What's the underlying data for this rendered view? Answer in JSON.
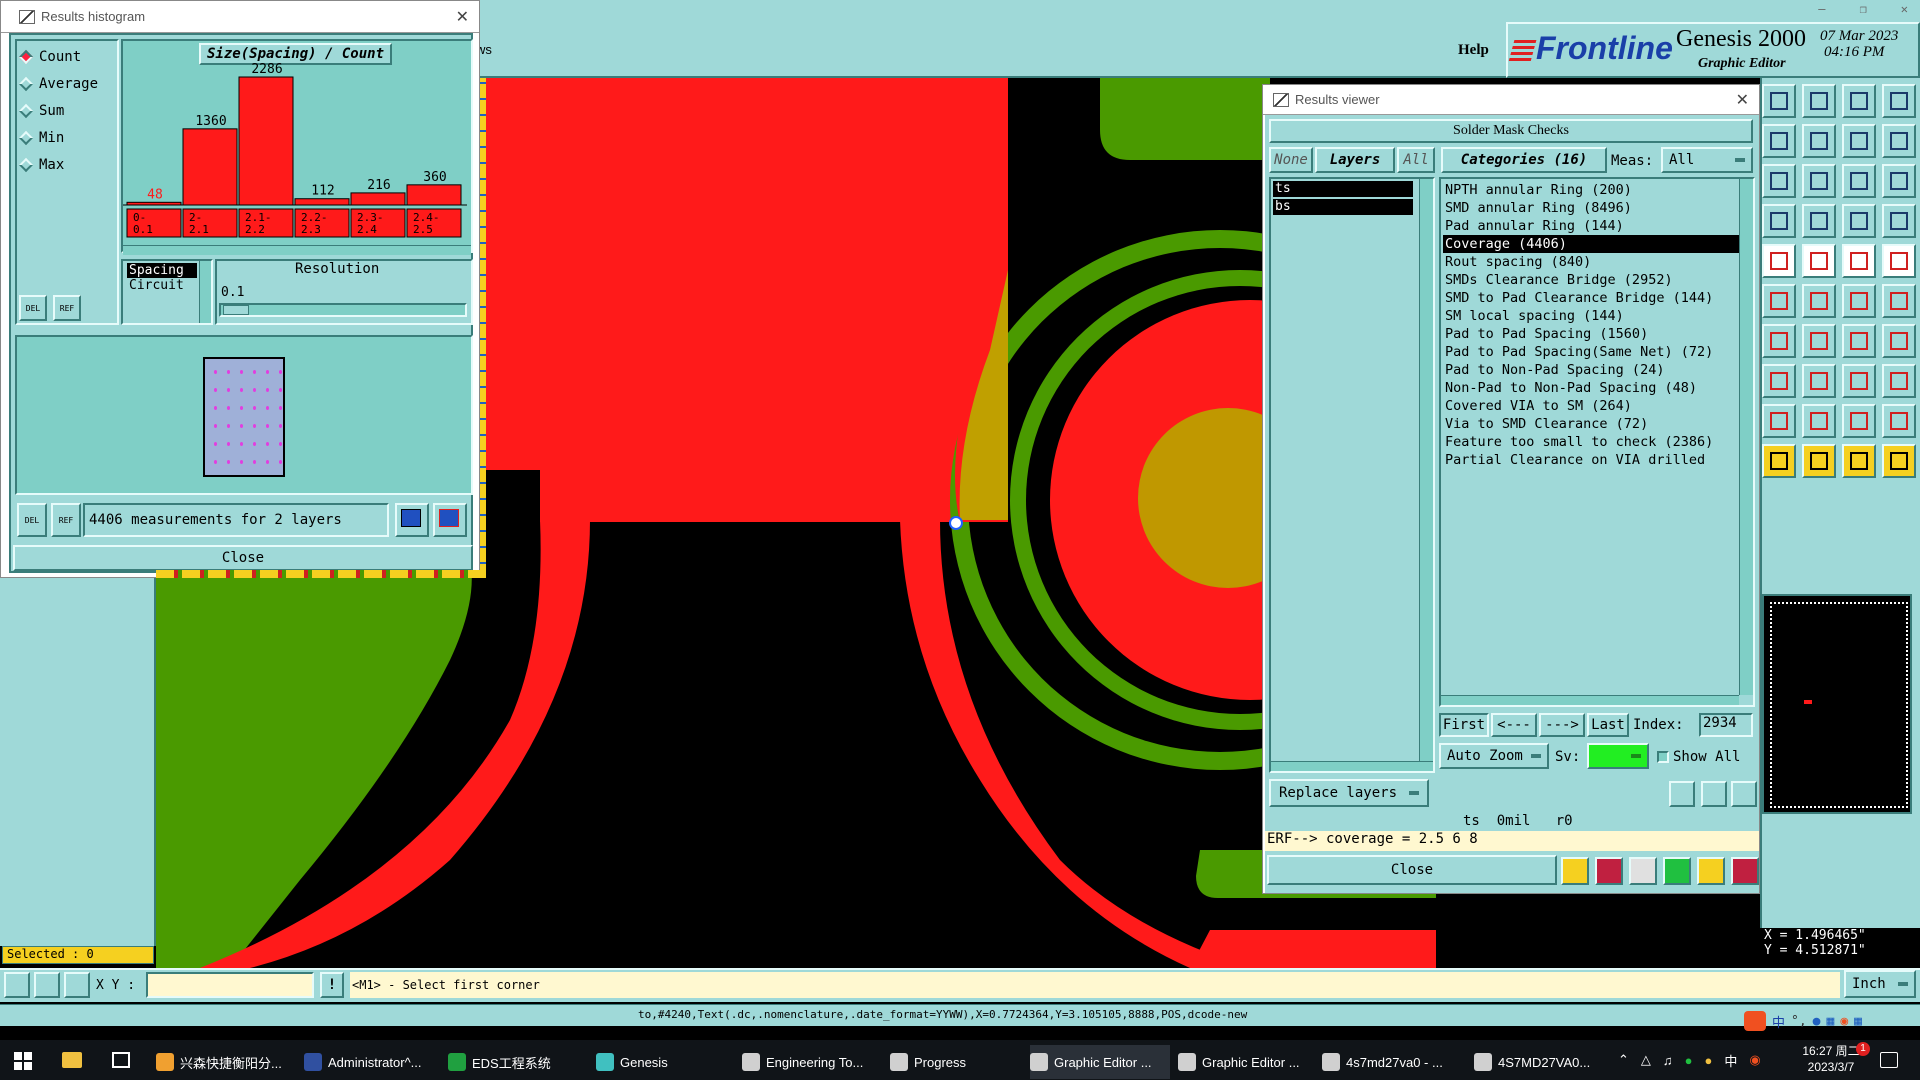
{
  "app": {
    "help_label": "Help",
    "brand": "Frontline",
    "product": "Genesis 2000",
    "subtitle": "Graphic Editor",
    "date": "07 Mar 2023",
    "time": "04:16 PM",
    "menu_fragment": "ws"
  },
  "histogram": {
    "window_title": "Results histogram",
    "modes": [
      "Count",
      "Average",
      "Sum",
      "Min",
      "Max"
    ],
    "selected_mode": "Count",
    "chart_title": "Size(Spacing) / Count",
    "measurements": "4406 measurements for 2 layers",
    "close_label": "Close",
    "list_items": [
      "Spacing",
      "Circuit"
    ],
    "resolution_label": "Resolution",
    "resolution_value": "0.1",
    "del_label": "DEL",
    "ref_label": "REF"
  },
  "chart_data": {
    "type": "bar",
    "title": "Size(Spacing) / Count",
    "categories": [
      "0-\n0.1",
      "2-\n2.1",
      "2.1-\n2.2",
      "2.2-\n2.3",
      "2.3-\n2.4",
      "2.4-\n2.5"
    ],
    "category_labels": [
      "0-0.1",
      "2-2.1",
      "2.1-2.2",
      "2.2-2.3",
      "2.3-2.4",
      "2.4-2.5"
    ],
    "values": [
      48,
      1360,
      2286,
      112,
      216,
      360
    ],
    "ylim": [
      0,
      2286
    ],
    "bar_color": "#ff1a1a",
    "label_color_first": "#ff1a1a"
  },
  "viewer": {
    "window_title": "Results viewer",
    "header": "Solder Mask Checks",
    "none_label": "None",
    "layers_label": "Layers",
    "all_label": "All",
    "categories_label": "Categories (16)",
    "meas_label": "Meas:",
    "meas_value": "All",
    "layers": [
      "ts",
      "bs"
    ],
    "categories": [
      "NPTH annular Ring (200)",
      "SMD annular Ring (8496)",
      "Pad annular Ring (144)",
      "Coverage (4406)",
      "Rout spacing (840)",
      "SMDs Clearance Bridge (2952)",
      "SMD to Pad Clearance Bridge (144)",
      "SM local spacing (144)",
      "Pad to Pad Spacing (1560)",
      "Pad to Pad Spacing(Same Net) (72)",
      "Pad to Non-Pad Spacing (24)",
      "Non-Pad to Non-Pad Spacing (48)",
      "Covered VIA to SM (264)",
      "Via to SMD Clearance (72)",
      "Feature too small to check (2386)",
      "Partial Clearance on VIA drilled"
    ],
    "selected_category": "Coverage (4406)",
    "first_label": "First",
    "prev_label": "<---",
    "next_label": "--->",
    "last_label": "Last",
    "index_label": "Index:",
    "index_value": "2934",
    "auto_zoom_label": "Auto Zoom",
    "sv_label": "Sv:",
    "show_all_label": "Show All",
    "replace_layers_label": "Replace layers",
    "status_line": "ts  0mil   r0",
    "erf_line": "ERF--> coverage = 2.5 6 8",
    "close_label": "Close"
  },
  "status": {
    "selected": "Selected : 0",
    "xy_label": "X Y :",
    "xy_value": "",
    "prompt": "<M1> - Select first corner",
    "units": "Inch",
    "coord_x": "X = 1.496465\"",
    "coord_y": "Y = 4.512871\"",
    "command_line": "to,#4240,Text(.dc,.nomenclature,.date_format=YYWW),X=0.7724364,Y=3.105105,8888,POS,dcode-new"
  },
  "taskbar": {
    "items": [
      {
        "label": "兴森快捷衡阳分...",
        "color": "#f0a030"
      },
      {
        "label": "Administrator^...",
        "color": "#3050a0"
      },
      {
        "label": "EDS工程系统",
        "color": "#20a040"
      },
      {
        "label": "Genesis",
        "color": "#40c0c0"
      },
      {
        "label": "Engineering To...",
        "color": "#d0d0d0"
      },
      {
        "label": "Progress",
        "color": "#d0d0d0"
      },
      {
        "label": "Graphic Editor ...",
        "color": "#d0d0d0"
      },
      {
        "label": "Graphic Editor ...",
        "color": "#d0d0d0"
      },
      {
        "label": "4s7md27va0 - ...",
        "color": "#d0d0d0"
      },
      {
        "label": "4S7MD27VA0...",
        "color": "#d0d0d0"
      }
    ],
    "tray_lang": "中",
    "tray_ime": "中",
    "clock_time": "16:27 周二",
    "clock_date": "2023/3/7",
    "notification_count": "1"
  }
}
